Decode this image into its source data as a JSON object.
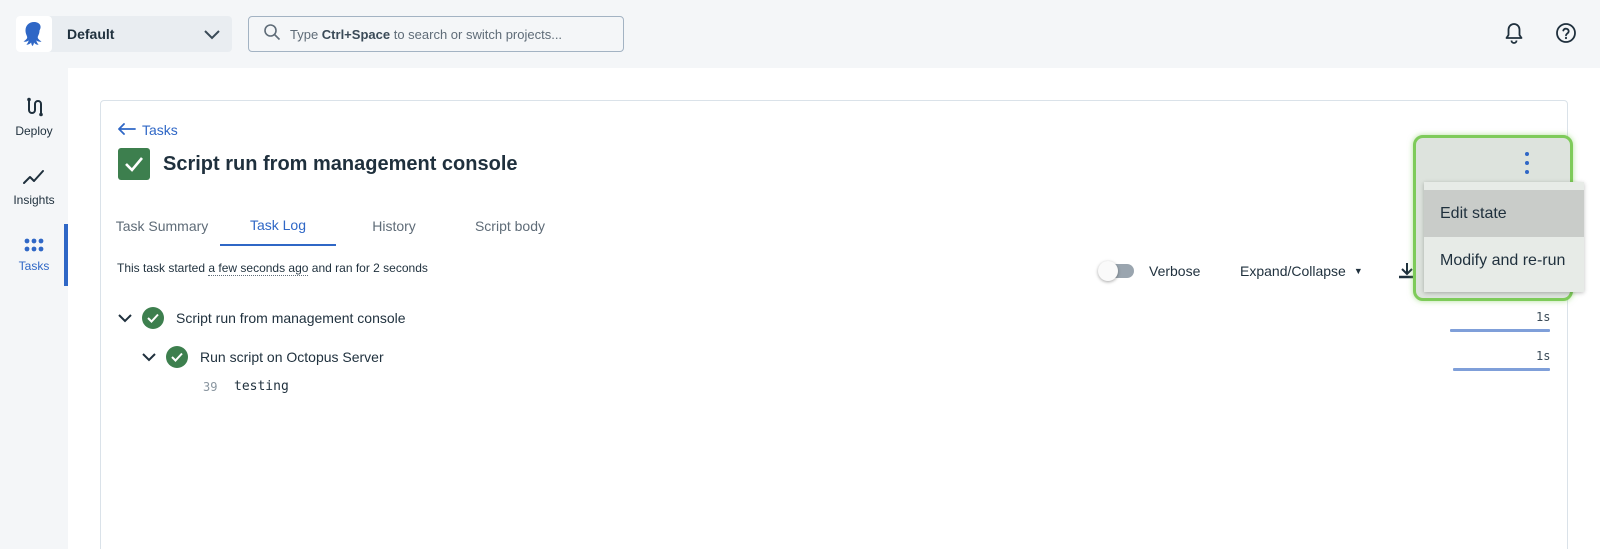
{
  "header": {
    "space_name": "Default",
    "search": {
      "prefix": "Type ",
      "shortcut": "Ctrl+Space",
      "suffix": " to search or switch projects..."
    }
  },
  "nav": {
    "items": [
      {
        "label": "Deploy",
        "icon": "deploy-icon",
        "active": false
      },
      {
        "label": "Insights",
        "icon": "insights-icon",
        "active": false
      },
      {
        "label": "Tasks",
        "icon": "tasks-icon",
        "active": true
      }
    ]
  },
  "page": {
    "breadcrumb": "Tasks",
    "title": "Script run from management console",
    "status": "success"
  },
  "tabs": [
    {
      "label": "Task Summary",
      "active": false
    },
    {
      "label": "Task Log",
      "active": true
    },
    {
      "label": "History",
      "active": false
    },
    {
      "label": "Script body",
      "active": false
    }
  ],
  "task_log": {
    "started_prefix": "This task started ",
    "started_relative": "a few seconds ago",
    "started_suffix": " and ran for 2 seconds",
    "verbose_label": "Verbose",
    "verbose_on": false,
    "expand_label": "Expand/Collapse",
    "entries": [
      {
        "label": "Script run from management console",
        "duration": "1s",
        "status": "success"
      },
      {
        "label": "Run script on Octopus Server",
        "duration": "1s",
        "status": "success"
      }
    ],
    "lines": [
      {
        "number": "39",
        "text": "testing"
      }
    ]
  },
  "menu": {
    "items": [
      "Edit state",
      "Modify and re-run"
    ]
  },
  "colors": {
    "accent": "#2f67c6",
    "success": "#3d7f4e",
    "highlight": "#7ecb5a"
  }
}
